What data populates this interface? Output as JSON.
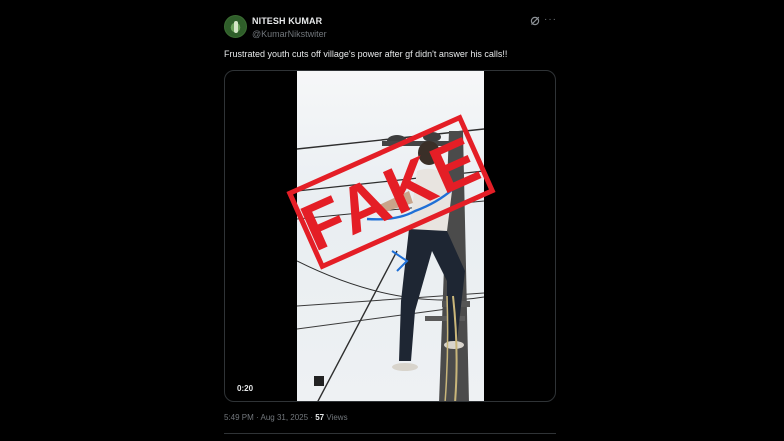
{
  "author": {
    "name": "NITESH KUMAR",
    "handle": "@KumarNikstwiter"
  },
  "tweet": {
    "text": "Frustrated youth cuts off village's power after gf didn't answer his calls!!"
  },
  "media": {
    "stamp_text": "FAKE",
    "video_time": "0:20"
  },
  "footer": {
    "time": "5:49 PM",
    "separator": "·",
    "date": "Aug 31, 2025",
    "views_count": "57",
    "views_label": "Views"
  },
  "icons": [
    "grok-icon",
    "more-icon"
  ],
  "colors": {
    "background": "#000000",
    "stamp_red": "#e41e26",
    "muted_text": "#71767b"
  }
}
